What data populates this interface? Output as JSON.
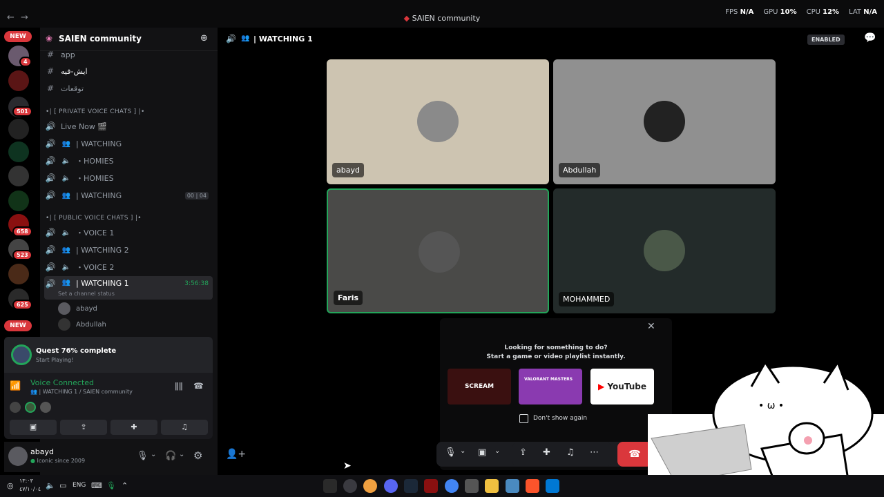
{
  "window": {
    "title": "SAIEN community"
  },
  "perf": {
    "fps_label": "FPS",
    "fps_value": "N/A",
    "gpu_label": "GPU",
    "gpu_value": "10%",
    "cpu_label": "CPU",
    "cpu_value": "12%",
    "lat_label": "LAT",
    "lat_value": "N/A"
  },
  "rail": {
    "new_top": "NEW",
    "new_bottom": "NEW",
    "badges": [
      "4",
      "501",
      "658",
      "523",
      "625"
    ]
  },
  "server": {
    "name": "SAIEN community"
  },
  "channels": {
    "text": [
      "app",
      "ايش-فيه",
      "توقعات"
    ],
    "private_category": "•| [ PRIVATE VOICE CHATS ] |•",
    "private": [
      "Live Now 🎬",
      "| WATCHING",
      "・HOMIES",
      "・HOMIES",
      "| WATCHING"
    ],
    "count_a": "00",
    "count_b": "04",
    "public_category": "•| [ PUBLIC VOICE CHATS ] |•",
    "public": [
      "・VOICE 1",
      "| WATCHING 2",
      "・VOICE 2",
      "| WATCHING 1"
    ],
    "active_timer": "3:56:38",
    "status_placeholder": "Set a channel status",
    "members": [
      "abayd",
      "Abdullah"
    ]
  },
  "quest": {
    "title": "Quest 76% complete",
    "subtitle": "Start Playing!"
  },
  "voice": {
    "status": "Voice Connected",
    "location": "| WATCHING 1 / SAIEN community"
  },
  "user": {
    "name": "abayd",
    "status": "Iconic since 2009"
  },
  "main": {
    "channel_title": "| WATCHING 1",
    "enabled_badge": "ENABLED",
    "participants": [
      "abayd",
      "Abdullah",
      "Faris",
      "MOHAMMED"
    ]
  },
  "suggest": {
    "line1": "Looking for something to do?",
    "line2": "Start a game or video playlist instantly.",
    "cards": [
      "SCREAM",
      "VALORANT MASTERS",
      "YouTube"
    ],
    "checkbox_label": "Don't show again"
  },
  "taskbar": {
    "time": "١٣:٠٣",
    "date": "٤٧/١٠/٠٤",
    "lang": "ENG"
  },
  "colors": {
    "accent_green": "#23a55a",
    "danger": "#da373c",
    "brand": "#5865f2"
  }
}
